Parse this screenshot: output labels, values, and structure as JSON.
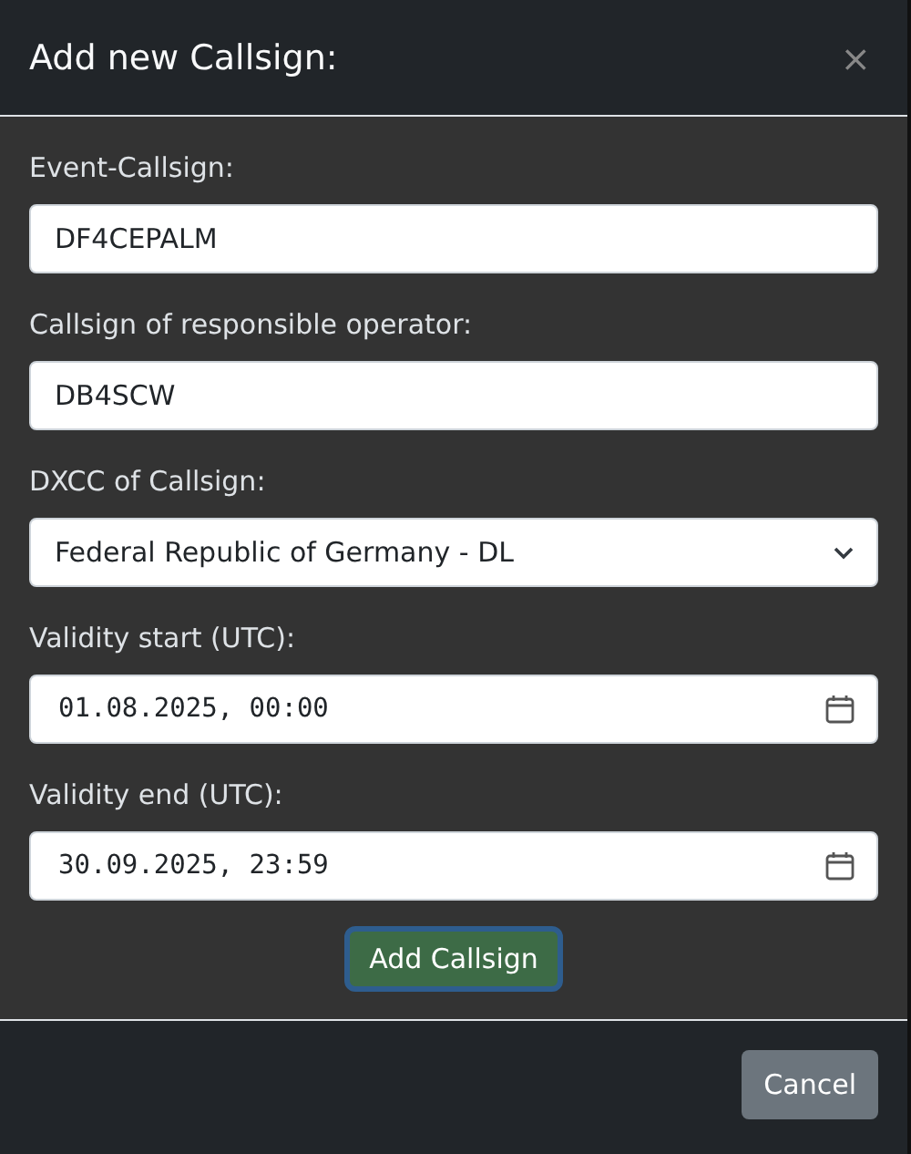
{
  "dialog": {
    "title": "Add new Callsign:",
    "close": "×"
  },
  "fields": [
    {
      "kind": "text",
      "label": "Event-Callsign:",
      "value": "DF4CEPALM"
    },
    {
      "kind": "text",
      "label": "Callsign of responsible operator:",
      "value": "DB4SCW"
    },
    {
      "kind": "select",
      "label": "DXCC of Callsign:",
      "value": "Federal Republic of Germany - DL"
    },
    {
      "kind": "datetime",
      "label": "Validity start (UTC):",
      "value": "01.08.2025, 00:00"
    },
    {
      "kind": "datetime",
      "label": "Validity end (UTC):",
      "value": "30.09.2025, 23:59"
    }
  ],
  "submit": {
    "label": "Add Callsign",
    "focused": true
  },
  "footer": {
    "buttons": [
      "Cancel"
    ]
  }
}
